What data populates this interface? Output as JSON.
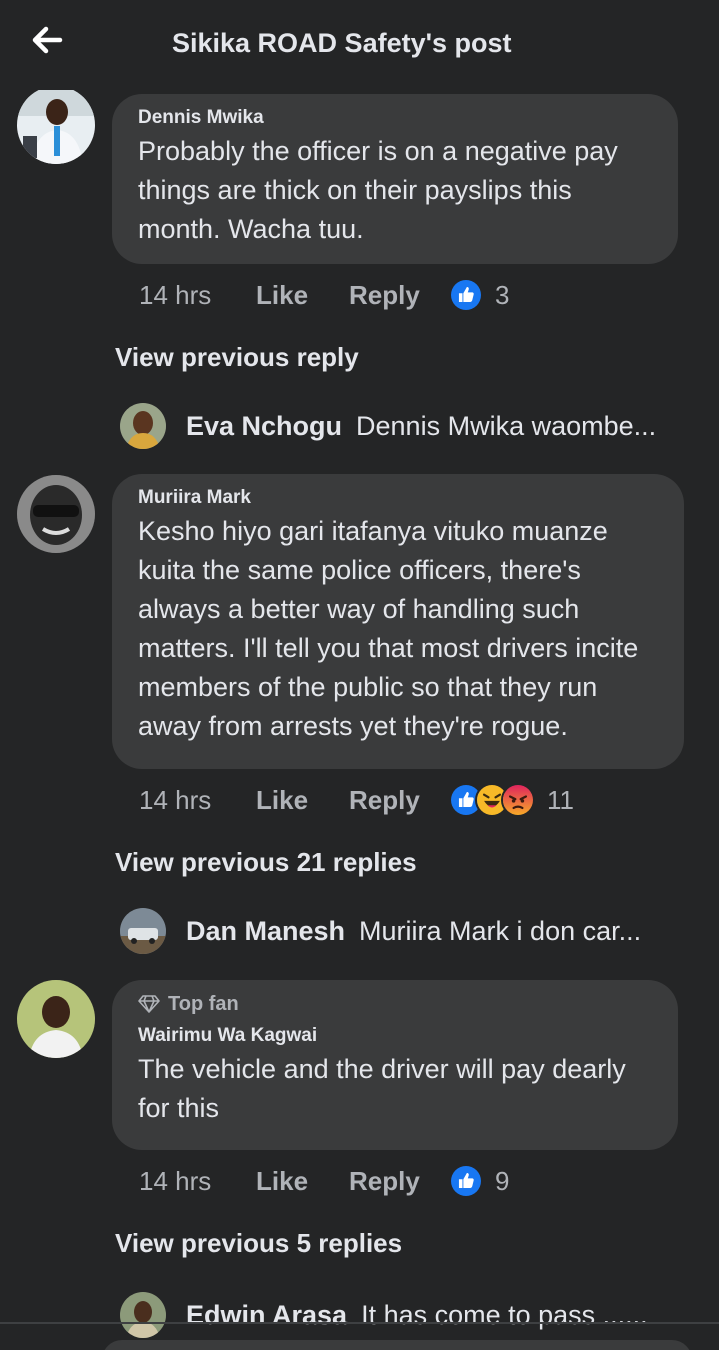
{
  "header": {
    "title": "Sikika ROAD Safety's post",
    "back_icon": "arrow-left-icon"
  },
  "comments": [
    {
      "author": "Dennis Mwika",
      "text": "Probably the officer is on a negative pay things are thick on their payslips this month. Wacha tuu.",
      "time": "14 hrs",
      "like_label": "Like",
      "reply_label": "Reply",
      "reactions": [
        "like"
      ],
      "reaction_count": "3",
      "view_previous": "View previous reply",
      "latest_reply": {
        "name": "Eva Nchogu",
        "text": "Dennis Mwika waombe..."
      }
    },
    {
      "author": "Muriira Mark",
      "text": "Kesho hiyo gari itafanya vituko muanze kuita the same police officers, there's always a better way of handling such matters. I'll tell you that most drivers incite members of the public so that they run away from arrests yet they're rogue.",
      "time": "14 hrs",
      "like_label": "Like",
      "reply_label": "Reply",
      "reactions": [
        "like",
        "haha",
        "angry"
      ],
      "reaction_count": "11",
      "view_previous": "View previous 21 replies",
      "latest_reply": {
        "name": "Dan Manesh",
        "text": "Muriira Mark i don car..."
      }
    },
    {
      "badge": "Top fan",
      "author": "Wairimu Wa Kagwai",
      "text": "The vehicle and the driver will pay dearly for this",
      "time": "14 hrs",
      "like_label": "Like",
      "reply_label": "Reply",
      "reactions": [
        "like"
      ],
      "reaction_count": "9",
      "view_previous": "View previous 5 replies",
      "latest_reply": {
        "name": "Edwin Arasa",
        "text": "It has come to pass ......"
      }
    }
  ],
  "colors": {
    "background": "#242526",
    "bubble": "#3a3b3c",
    "text_primary": "#e4e6eb",
    "text_secondary": "#b0b3b8",
    "like_blue": "#1877f2"
  }
}
